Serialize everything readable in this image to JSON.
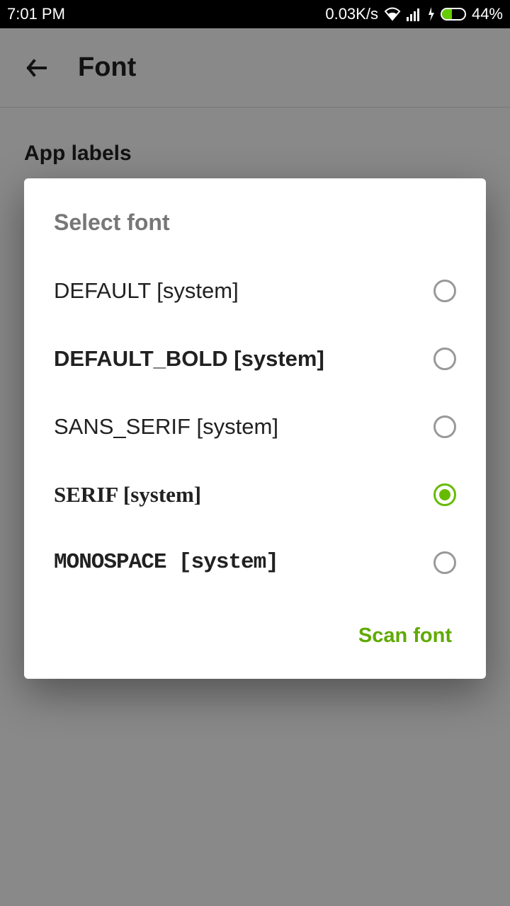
{
  "status": {
    "time": "7:01 PM",
    "speed": "0.03K/s",
    "battery_pct": "44%"
  },
  "header": {
    "title": "Font"
  },
  "section": {
    "label": "App labels"
  },
  "dialog": {
    "title": "Select font",
    "options": [
      {
        "label": "DEFAULT [system]",
        "selected": false
      },
      {
        "label": "DEFAULT_BOLD [system]",
        "selected": false
      },
      {
        "label": "SANS_SERIF [system]",
        "selected": false
      },
      {
        "label": "SERIF [system]",
        "selected": true
      },
      {
        "label": "MONOSPACE [system]",
        "selected": false
      }
    ],
    "action": "Scan font"
  },
  "colors": {
    "accent": "#66bb00"
  }
}
